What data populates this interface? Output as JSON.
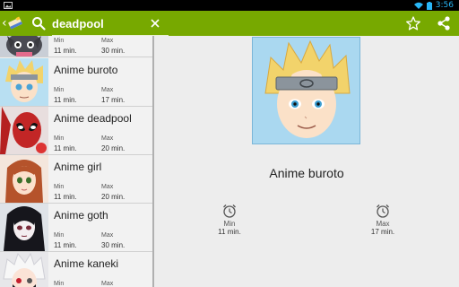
{
  "status_bar": {
    "time": "3:56"
  },
  "action_bar": {
    "search_value": "deadpool",
    "icons": [
      "app-logo-icon",
      "search-icon",
      "close-icon",
      "star-icon",
      "share-icon"
    ],
    "color": "#77a900"
  },
  "list": [
    {
      "title": "",
      "min_label": "Min",
      "min_value": "11 min.",
      "max_label": "Max",
      "max_value": "30 min."
    },
    {
      "title": "Anime buroto",
      "min_label": "Min",
      "min_value": "11 min.",
      "max_label": "Max",
      "max_value": "17 min."
    },
    {
      "title": "Anime deadpool",
      "min_label": "Min",
      "min_value": "11 min.",
      "max_label": "Max",
      "max_value": "20 min."
    },
    {
      "title": "Anime girl",
      "min_label": "Min",
      "min_value": "11 min.",
      "max_label": "Max",
      "max_value": "20 min."
    },
    {
      "title": "Anime goth",
      "min_label": "Min",
      "min_value": "11 min.",
      "max_label": "Max",
      "max_value": "30 min."
    },
    {
      "title": "Anime kaneki",
      "min_label": "Min",
      "min_value": "",
      "max_label": "Max",
      "max_value": ""
    }
  ],
  "detail": {
    "title": "Anime buroto",
    "min_label": "Min",
    "min_value": "11 min.",
    "max_label": "Max",
    "max_value": "17 min."
  }
}
